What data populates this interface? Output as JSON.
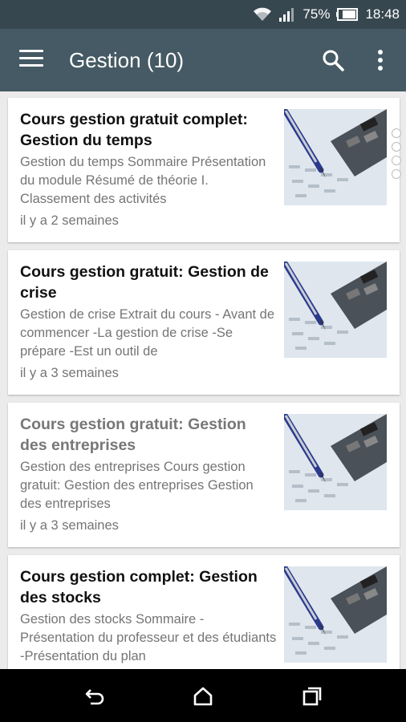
{
  "status_bar": {
    "battery_percent": "75%",
    "time": "18:48"
  },
  "app_bar": {
    "title": "Gestion (10)",
    "menu_icon": "hamburger-menu-icon",
    "search_icon": "search-icon",
    "more_icon": "more-vert-icon"
  },
  "articles": [
    {
      "title": "Cours gestion gratuit complet: Gestion du temps",
      "description": "Gestion du temps Sommaire Présentation du module Résumé de théorie I. Classement des activités",
      "time": "il y a 2 semaines",
      "read": false
    },
    {
      "title": "Cours gestion gratuit: Gestion de crise",
      "description": "Gestion de crise Extrait du cours - Avant de commencer -La gestion de crise -Se prépare -Est un outil de",
      "time": "il y a 3 semaines",
      "read": false
    },
    {
      "title": "Cours gestion gratuit: Gestion des entreprises",
      "description": "Gestion des entreprises Cours gestion gratuit: Gestion des entreprises Gestion des entreprises",
      "time": "il y a 3 semaines",
      "read": true
    },
    {
      "title": "Cours gestion complet: Gestion des stocks",
      "description": "Gestion des stocks Sommaire - Présentation du professeur et des étudiants -Présentation du plan",
      "time": "",
      "read": false
    }
  ],
  "nav_bar": {
    "back_icon": "back-icon",
    "home_icon": "home-icon",
    "recents_icon": "recents-icon"
  }
}
